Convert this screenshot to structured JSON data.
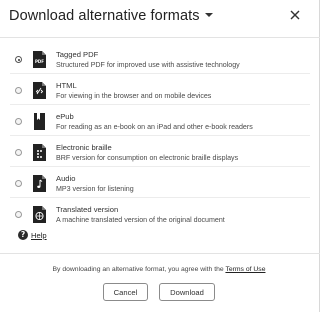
{
  "dialog": {
    "title": "Download alternative formats",
    "close_label": "×"
  },
  "options": [
    {
      "title": "Tagged PDF",
      "description": "Structured PDF for improved use with assistive technology",
      "selected": true,
      "icon": "pdf-file-icon",
      "icon_text": "PDF"
    },
    {
      "title": "HTML",
      "description": "For viewing in the browser and on mobile devices",
      "selected": false,
      "icon": "html-file-icon"
    },
    {
      "title": "ePub",
      "description": "For reading as an e-book on an iPad and other e-book readers",
      "selected": false,
      "icon": "epub-file-icon"
    },
    {
      "title": "Electronic braille",
      "description": "BRF version for consumption on electronic braille displays",
      "selected": false,
      "icon": "braille-file-icon"
    },
    {
      "title": "Audio",
      "description": "MP3 version for listening",
      "selected": false,
      "icon": "audio-file-icon"
    },
    {
      "title": "Translated version",
      "description": "A machine translated version of the original document",
      "selected": false,
      "icon": "translate-file-icon"
    }
  ],
  "help": {
    "icon_text": "?",
    "label": "Help"
  },
  "footer": {
    "agreement_prefix": "By downloading an alternative format, you agree with the ",
    "terms_label": "Terms of Use",
    "cancel_label": "Cancel",
    "download_label": "Download"
  }
}
